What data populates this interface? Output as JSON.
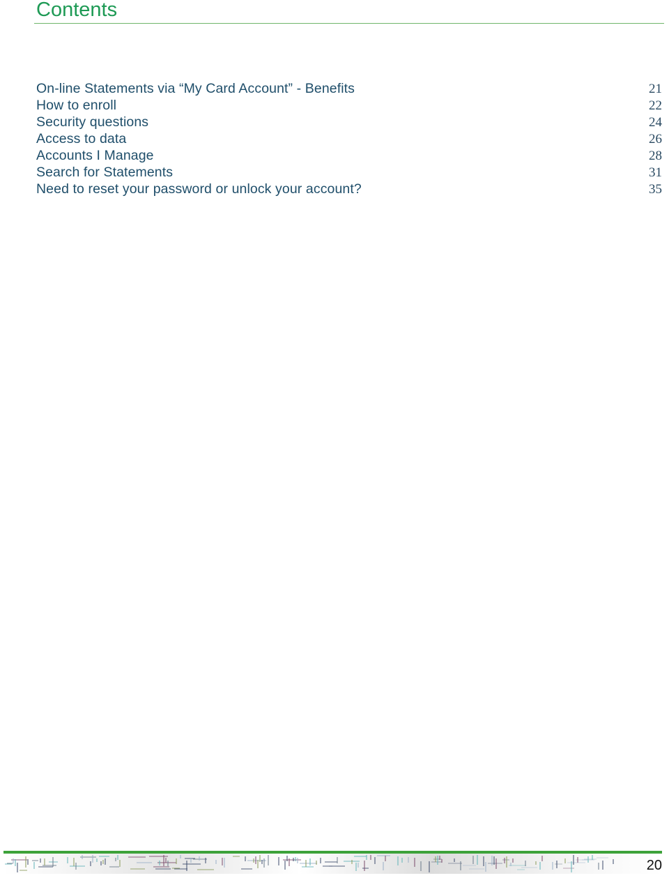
{
  "header": {
    "title": "Contents"
  },
  "toc": [
    {
      "label": "On-line Statements via “My Card Account” - Benefits",
      "page": "21"
    },
    {
      "label": "How to enroll",
      "page": "22"
    },
    {
      "label": "Security questions",
      "page": "24"
    },
    {
      "label": "Access to data",
      "page": "26"
    },
    {
      "label": "Accounts I Manage",
      "page": "28"
    },
    {
      "label": "Search for Statements",
      "page": "31"
    },
    {
      "label": "Need to reset your password or unlock your account?",
      "page": "35"
    }
  ],
  "footer": {
    "page_number": "20",
    "accent_color": "#3da23a"
  },
  "colors": {
    "title": "#1e9a55",
    "toc_text": "#1f4e6a"
  }
}
